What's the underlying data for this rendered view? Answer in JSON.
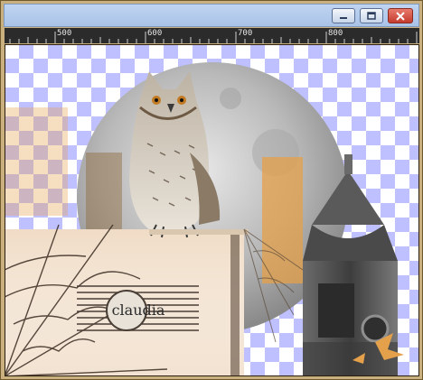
{
  "window": {
    "title": "",
    "controls": {
      "minimize": "minimize-icon",
      "maximize": "maximize-icon",
      "close": "close-icon"
    }
  },
  "ruler": {
    "labels": [
      "500",
      "600",
      "700",
      "800"
    ]
  },
  "artwork": {
    "signature": "claudia"
  },
  "colors": {
    "titlebar": "#a9c3e8",
    "ruler": "#2b2b2b",
    "checker": "#bfc0ff",
    "frame": "#c9b07e",
    "accent_orange": "#e4a04a"
  }
}
